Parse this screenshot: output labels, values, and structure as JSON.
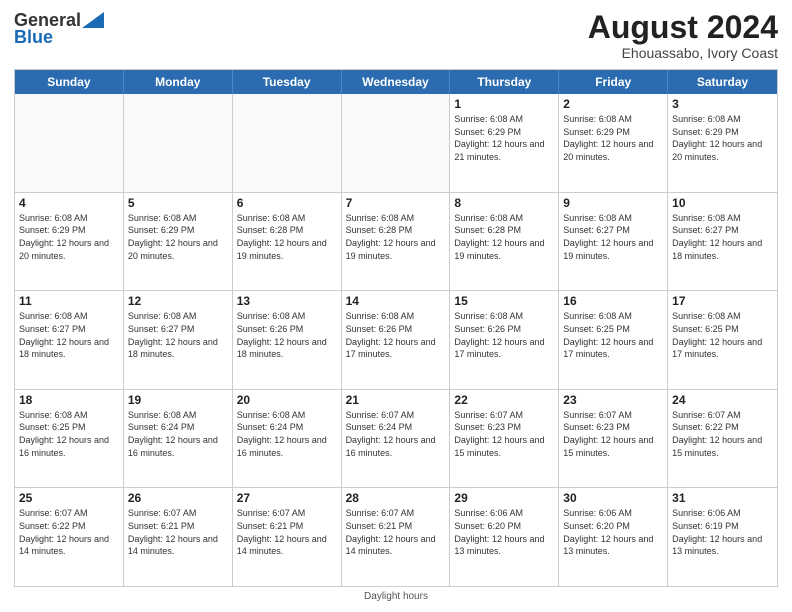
{
  "header": {
    "logo_general": "General",
    "logo_blue": "Blue",
    "month_title": "August 2024",
    "subtitle": "Ehouassabo, Ivory Coast"
  },
  "days_of_week": [
    "Sunday",
    "Monday",
    "Tuesday",
    "Wednesday",
    "Thursday",
    "Friday",
    "Saturday"
  ],
  "footer": {
    "note": "Daylight hours"
  },
  "weeks": [
    {
      "days": [
        {
          "num": "",
          "info": "",
          "empty": true
        },
        {
          "num": "",
          "info": "",
          "empty": true
        },
        {
          "num": "",
          "info": "",
          "empty": true
        },
        {
          "num": "",
          "info": "",
          "empty": true
        },
        {
          "num": "1",
          "info": "Sunrise: 6:08 AM\nSunset: 6:29 PM\nDaylight: 12 hours\nand 21 minutes."
        },
        {
          "num": "2",
          "info": "Sunrise: 6:08 AM\nSunset: 6:29 PM\nDaylight: 12 hours\nand 20 minutes."
        },
        {
          "num": "3",
          "info": "Sunrise: 6:08 AM\nSunset: 6:29 PM\nDaylight: 12 hours\nand 20 minutes."
        }
      ]
    },
    {
      "days": [
        {
          "num": "4",
          "info": "Sunrise: 6:08 AM\nSunset: 6:29 PM\nDaylight: 12 hours\nand 20 minutes."
        },
        {
          "num": "5",
          "info": "Sunrise: 6:08 AM\nSunset: 6:29 PM\nDaylight: 12 hours\nand 20 minutes."
        },
        {
          "num": "6",
          "info": "Sunrise: 6:08 AM\nSunset: 6:28 PM\nDaylight: 12 hours\nand 19 minutes."
        },
        {
          "num": "7",
          "info": "Sunrise: 6:08 AM\nSunset: 6:28 PM\nDaylight: 12 hours\nand 19 minutes."
        },
        {
          "num": "8",
          "info": "Sunrise: 6:08 AM\nSunset: 6:28 PM\nDaylight: 12 hours\nand 19 minutes."
        },
        {
          "num": "9",
          "info": "Sunrise: 6:08 AM\nSunset: 6:27 PM\nDaylight: 12 hours\nand 19 minutes."
        },
        {
          "num": "10",
          "info": "Sunrise: 6:08 AM\nSunset: 6:27 PM\nDaylight: 12 hours\nand 18 minutes."
        }
      ]
    },
    {
      "days": [
        {
          "num": "11",
          "info": "Sunrise: 6:08 AM\nSunset: 6:27 PM\nDaylight: 12 hours\nand 18 minutes."
        },
        {
          "num": "12",
          "info": "Sunrise: 6:08 AM\nSunset: 6:27 PM\nDaylight: 12 hours\nand 18 minutes."
        },
        {
          "num": "13",
          "info": "Sunrise: 6:08 AM\nSunset: 6:26 PM\nDaylight: 12 hours\nand 18 minutes."
        },
        {
          "num": "14",
          "info": "Sunrise: 6:08 AM\nSunset: 6:26 PM\nDaylight: 12 hours\nand 17 minutes."
        },
        {
          "num": "15",
          "info": "Sunrise: 6:08 AM\nSunset: 6:26 PM\nDaylight: 12 hours\nand 17 minutes."
        },
        {
          "num": "16",
          "info": "Sunrise: 6:08 AM\nSunset: 6:25 PM\nDaylight: 12 hours\nand 17 minutes."
        },
        {
          "num": "17",
          "info": "Sunrise: 6:08 AM\nSunset: 6:25 PM\nDaylight: 12 hours\nand 17 minutes."
        }
      ]
    },
    {
      "days": [
        {
          "num": "18",
          "info": "Sunrise: 6:08 AM\nSunset: 6:25 PM\nDaylight: 12 hours\nand 16 minutes."
        },
        {
          "num": "19",
          "info": "Sunrise: 6:08 AM\nSunset: 6:24 PM\nDaylight: 12 hours\nand 16 minutes."
        },
        {
          "num": "20",
          "info": "Sunrise: 6:08 AM\nSunset: 6:24 PM\nDaylight: 12 hours\nand 16 minutes."
        },
        {
          "num": "21",
          "info": "Sunrise: 6:07 AM\nSunset: 6:24 PM\nDaylight: 12 hours\nand 16 minutes."
        },
        {
          "num": "22",
          "info": "Sunrise: 6:07 AM\nSunset: 6:23 PM\nDaylight: 12 hours\nand 15 minutes."
        },
        {
          "num": "23",
          "info": "Sunrise: 6:07 AM\nSunset: 6:23 PM\nDaylight: 12 hours\nand 15 minutes."
        },
        {
          "num": "24",
          "info": "Sunrise: 6:07 AM\nSunset: 6:22 PM\nDaylight: 12 hours\nand 15 minutes."
        }
      ]
    },
    {
      "days": [
        {
          "num": "25",
          "info": "Sunrise: 6:07 AM\nSunset: 6:22 PM\nDaylight: 12 hours\nand 14 minutes."
        },
        {
          "num": "26",
          "info": "Sunrise: 6:07 AM\nSunset: 6:21 PM\nDaylight: 12 hours\nand 14 minutes."
        },
        {
          "num": "27",
          "info": "Sunrise: 6:07 AM\nSunset: 6:21 PM\nDaylight: 12 hours\nand 14 minutes."
        },
        {
          "num": "28",
          "info": "Sunrise: 6:07 AM\nSunset: 6:21 PM\nDaylight: 12 hours\nand 14 minutes."
        },
        {
          "num": "29",
          "info": "Sunrise: 6:06 AM\nSunset: 6:20 PM\nDaylight: 12 hours\nand 13 minutes."
        },
        {
          "num": "30",
          "info": "Sunrise: 6:06 AM\nSunset: 6:20 PM\nDaylight: 12 hours\nand 13 minutes."
        },
        {
          "num": "31",
          "info": "Sunrise: 6:06 AM\nSunset: 6:19 PM\nDaylight: 12 hours\nand 13 minutes."
        }
      ]
    }
  ]
}
